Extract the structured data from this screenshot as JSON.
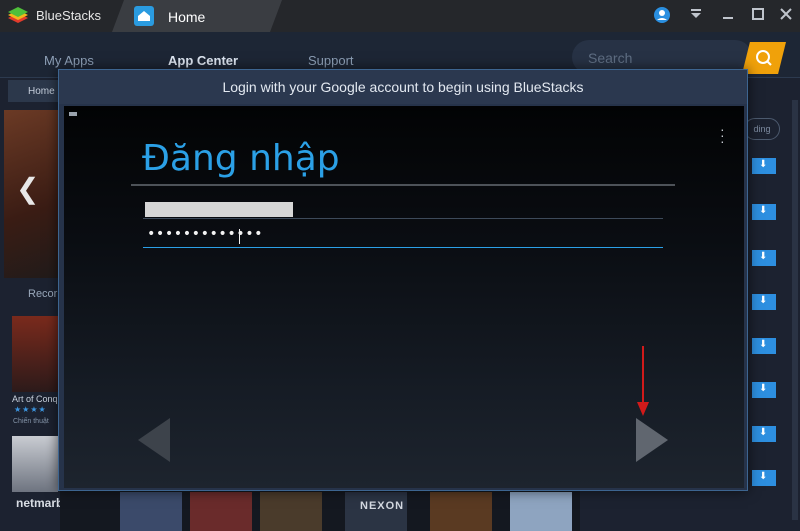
{
  "titlebar": {
    "app_name": "BlueStacks",
    "tab_label": "Home",
    "icons": [
      "account-icon",
      "dropdown-icon",
      "minimize-icon",
      "maximize-icon",
      "close-icon"
    ]
  },
  "nav": {
    "items": [
      "My Apps",
      "App Center",
      "Support"
    ],
    "active": "App Center",
    "search_placeholder": "Search"
  },
  "background": {
    "breadcrumb": "Home",
    "section_label": "Recor",
    "card1_name": "Art of Conq",
    "card1_sub": "Chiến thuật",
    "card2_brand": "netmarble",
    "nexon_label": "NEXON",
    "pill_label": "ding",
    "card1_stars": "★★★★"
  },
  "dialog": {
    "title": "Login with your Google account to begin using BlueStacks",
    "signin_heading": "Đăng nhập",
    "password_value": "•••••••••••••"
  },
  "colors": {
    "accent": "#2ba0e6",
    "search_button": "#f0a10a",
    "annotation_arrow": "#d11a1a"
  }
}
